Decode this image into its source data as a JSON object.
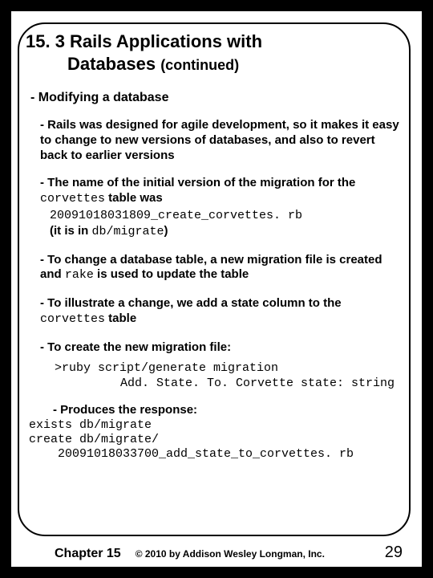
{
  "title": {
    "line1": "15. 3 Rails Applications with",
    "line2": "Databases ",
    "cont": "(continued)"
  },
  "b1": "- Modifying a database",
  "b2": "- Rails was designed for agile development, so it makes it easy to change to new versions of databases, and also to revert back to earlier versions",
  "b3a": "- The name of the initial version of the migration for the ",
  "b3_code1": "corvettes",
  "b3b": " table was",
  "b3_file": "20091018031809_create_corvettes. rb",
  "b3c_a": "(it is in ",
  "b3c_code": "db/migrate",
  "b3c_b": ")",
  "b4a": "- To change a database table, a new migration file is created and ",
  "b4_code": "rake",
  "b4b": " is used to update the table",
  "b5a": "- To illustrate a change, we add a state column to the ",
  "b5_code": "corvettes",
  "b5b": " table",
  "b6": "- To create the new migration file:",
  "cmd1": ">ruby script/generate migration",
  "cmd2": "Add. State. To. Corvette state: string",
  "b7": "- Produces the response:",
  "resp1": "exists db/migrate",
  "resp2": "create db/migrate/",
  "resp3": "20091018033700_add_state_to_corvettes. rb",
  "footer": {
    "chapter": "Chapter 15",
    "copy": "© 2010 by Addison Wesley Longman, Inc.",
    "page": "29"
  }
}
